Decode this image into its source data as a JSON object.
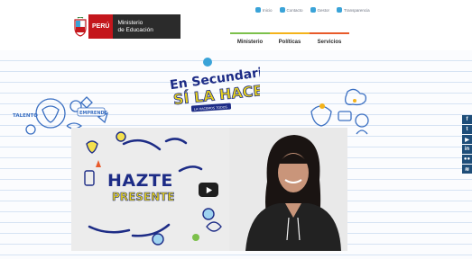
{
  "header": {
    "logo": {
      "country": "PERÚ",
      "ministry": "Ministerio\nde Educación"
    },
    "top_links": [
      {
        "label": "Inicio",
        "icon": "home-icon"
      },
      {
        "label": "Contacto",
        "icon": "mail-icon"
      },
      {
        "label": "Gestor",
        "icon": "user-icon"
      },
      {
        "label": "Transparencia",
        "icon": "doc-icon"
      }
    ],
    "nav": [
      {
        "label": "Ministerio"
      },
      {
        "label": "Políticas"
      },
      {
        "label": "Servicios"
      }
    ]
  },
  "campaign": {
    "line1": "En Secundaria",
    "line2": "SÍ LA HACES",
    "tagline": "LA HACEMOS TODOS"
  },
  "video": {
    "title_line1": "HAZTE",
    "title_line2": "PRESENTE",
    "play_icon": "play-icon"
  },
  "doodles": {
    "left_words": [
      "TALENTO",
      "EMPRENDE"
    ]
  },
  "social": [
    {
      "label": "f",
      "icon": "facebook-icon"
    },
    {
      "label": "t",
      "icon": "twitter-icon"
    },
    {
      "label": "▶",
      "icon": "youtube-icon"
    },
    {
      "label": "in",
      "icon": "linkedin-icon"
    },
    {
      "label": "●●",
      "icon": "flickr-icon"
    },
    {
      "label": "≋",
      "icon": "rss-icon"
    }
  ],
  "colors": {
    "peru_red": "#c4161c",
    "nav_green": "#7cc04b",
    "nav_yellow": "#f4b31a",
    "nav_orange": "#e85a2a",
    "campaign_blue": "#1d2c86",
    "campaign_yellow": "#e8d21c",
    "social_blue": "#1f4e79"
  }
}
